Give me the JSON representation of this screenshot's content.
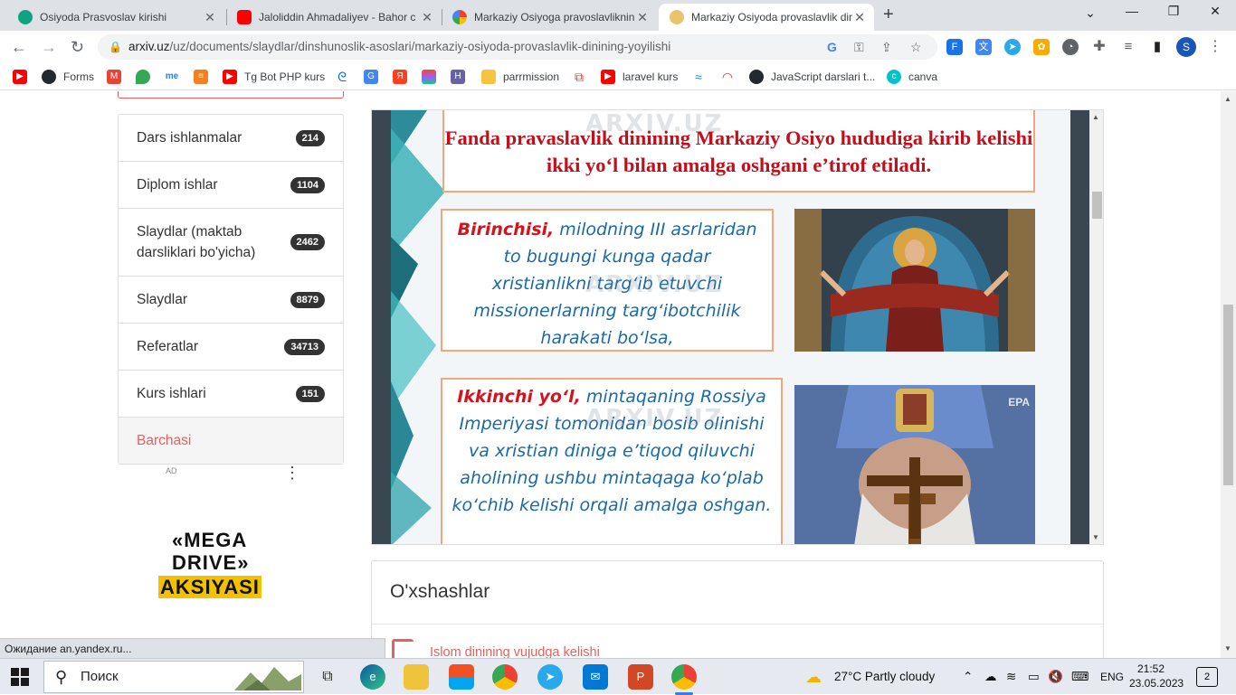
{
  "browser": {
    "tabs": [
      {
        "title": "Osiyoda Prasvoslav kirishi",
        "icon": "chatgpt-icon",
        "color": "#10a37f",
        "active": false
      },
      {
        "title": "Jaloliddin Ahmadaliyev - Bahor c",
        "icon": "youtube-icon",
        "color": "#ff0000",
        "active": false
      },
      {
        "title": "Markaziy Osiyoga pravoslavliknin",
        "icon": "google-icon",
        "color": "#4285f4",
        "active": false
      },
      {
        "title": "Markaziy Osiyoda provaslavlik din",
        "icon": "arxiv-icon",
        "color": "#e9c46a",
        "active": true
      }
    ],
    "url_host": "arxiv.uz",
    "url_path": "/uz/documents/slaydlar/dinshunoslik-asoslari/markaziy-osiyoda-provaslavlik-dinining-yoyilishi",
    "profile_initial": "S",
    "bookmarks": [
      {
        "label": "",
        "icon": "youtube-icon",
        "color": "#ff0000"
      },
      {
        "label": "Forms",
        "icon": "github-icon",
        "color": "#24292f"
      },
      {
        "label": "",
        "icon": "gmail-icon",
        "color": "#ea4335"
      },
      {
        "label": "",
        "icon": "maps-icon",
        "color": "#34a853"
      },
      {
        "label": "",
        "icon": "me-icon",
        "color": "#2f7de1"
      },
      {
        "label": "",
        "icon": "stackoverflow-icon",
        "color": "#f48024"
      },
      {
        "label": "Tg Bot PHP kurs",
        "icon": "youtube-icon",
        "color": "#ff0000"
      },
      {
        "label": "",
        "icon": "swirl-icon",
        "color": "#0066cc"
      },
      {
        "label": "",
        "icon": "translate-icon",
        "color": "#4285f4"
      },
      {
        "label": "",
        "icon": "yandex-icon",
        "color": "#fc3f1d"
      },
      {
        "label": "",
        "icon": "figma-icon",
        "color": "#a259ff"
      },
      {
        "label": "",
        "icon": "heroku-icon",
        "color": "#6762a6"
      },
      {
        "label": "parrmission",
        "icon": "folder-icon",
        "color": "#f5c542"
      },
      {
        "label": "",
        "icon": "laravel-icon",
        "color": "#ff2d20"
      },
      {
        "label": "laravel kurs",
        "icon": "youtube-icon",
        "color": "#ff0000"
      },
      {
        "label": "",
        "icon": "wave-icon",
        "color": "#1e88e5"
      },
      {
        "label": "",
        "icon": "speedometer-icon",
        "color": "#d32f2f"
      },
      {
        "label": "JavaScript darslari t...",
        "icon": "github-icon",
        "color": "#24292f"
      },
      {
        "label": "canva",
        "icon": "canva-icon",
        "color": "#00c4cc"
      }
    ]
  },
  "sidebar": {
    "items": [
      {
        "label": "Dars ishlanmalar",
        "count": "214"
      },
      {
        "label": "Diplom ishlar",
        "count": "1104"
      },
      {
        "label": "Slaydlar (maktab darsliklari bo'yicha)",
        "count": "2462"
      },
      {
        "label": "Slaydlar",
        "count": "8879"
      },
      {
        "label": "Referatlar",
        "count": "34713"
      },
      {
        "label": "Kurs ishlari",
        "count": "151"
      },
      {
        "label": "Barchasi",
        "count": ""
      }
    ],
    "ad_label": "AD",
    "ad_line1": "«MEGA",
    "ad_line2": "DRIVE»",
    "ad_line3": "AKSIYASI"
  },
  "slide": {
    "heading": "Fanda pravaslavlik dinining Markaziy Osiyo hududiga kirib kelishi ikki yo‘l bilan amalga oshgani e’tirof etiladi.",
    "box1_lead": "Birinchisi,",
    "box1_text": " milodning III asrlaridan to bugungi kunga qadar xristianlikni targ‘ib etuvchi missionerlarning targ‘ibotchilik harakati bo‘lsa,",
    "box2_lead": "Ikkinchi yo‘l,",
    "box2_text": " mintaqaning Rossiya Imperiyasi tomonidan bosib olinishi va xristian diniga e’tiqod qiluvchi aholining ushbu mintaqaga ko‘plab ko‘chib kelishi orqali amalga oshgan.",
    "watermark": "ARXIV.UZ",
    "image2_credit": "EPA"
  },
  "similar": {
    "heading": "O'xshashlar",
    "first_item": "Islom dinining vujudga kelishi"
  },
  "status_text": "Ожидание an.yandex.ru...",
  "taskbar": {
    "search_placeholder": "Поиск",
    "weather": "27°C  Partly cloudy",
    "lang": "ENG",
    "time": "21:52",
    "date": "23.05.2023",
    "notifications": "2"
  }
}
